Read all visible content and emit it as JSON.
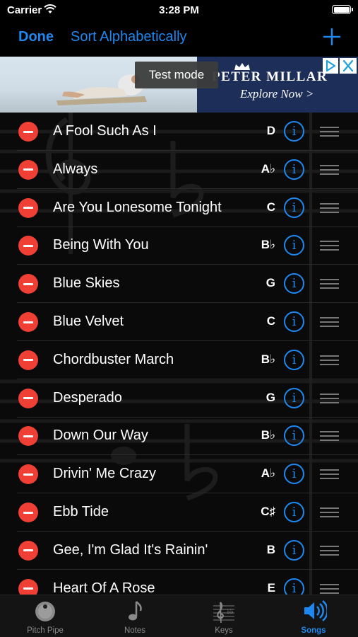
{
  "status_bar": {
    "carrier": "Carrier",
    "time": "3:28 PM"
  },
  "nav": {
    "done_label": "Done",
    "sort_label": "Sort Alphabetically",
    "add_icon": "plus-icon"
  },
  "ad": {
    "test_mode": "Test mode",
    "brand": "PETER MILLAR",
    "cta": "Explore Now >"
  },
  "songs": [
    {
      "title": "A Fool Such As I",
      "key": "D"
    },
    {
      "title": "Always",
      "key": "A♭"
    },
    {
      "title": "Are You Lonesome Tonight",
      "key": "C"
    },
    {
      "title": "Being With You",
      "key": "B♭"
    },
    {
      "title": "Blue Skies",
      "key": "G"
    },
    {
      "title": "Blue Velvet",
      "key": "C"
    },
    {
      "title": "Chordbuster March",
      "key": "B♭"
    },
    {
      "title": "Desperado",
      "key": "G"
    },
    {
      "title": "Down Our Way",
      "key": "B♭"
    },
    {
      "title": "Drivin' Me Crazy",
      "key": "A♭"
    },
    {
      "title": "Ebb Tide",
      "key": "C♯"
    },
    {
      "title": "Gee, I'm Glad It's Rainin'",
      "key": "B"
    },
    {
      "title": "Heart Of A Rose",
      "key": "E"
    }
  ],
  "tabs": [
    {
      "label": "Pitch Pipe",
      "icon": "pitch-pipe-icon"
    },
    {
      "label": "Notes",
      "icon": "music-note-icon"
    },
    {
      "label": "Keys",
      "icon": "treble-clef-icon"
    },
    {
      "label": "Songs",
      "icon": "speaker-icon",
      "active": true
    }
  ],
  "colors": {
    "accent": "#1e88f0",
    "delete": "#f04035",
    "background": "#000000"
  }
}
